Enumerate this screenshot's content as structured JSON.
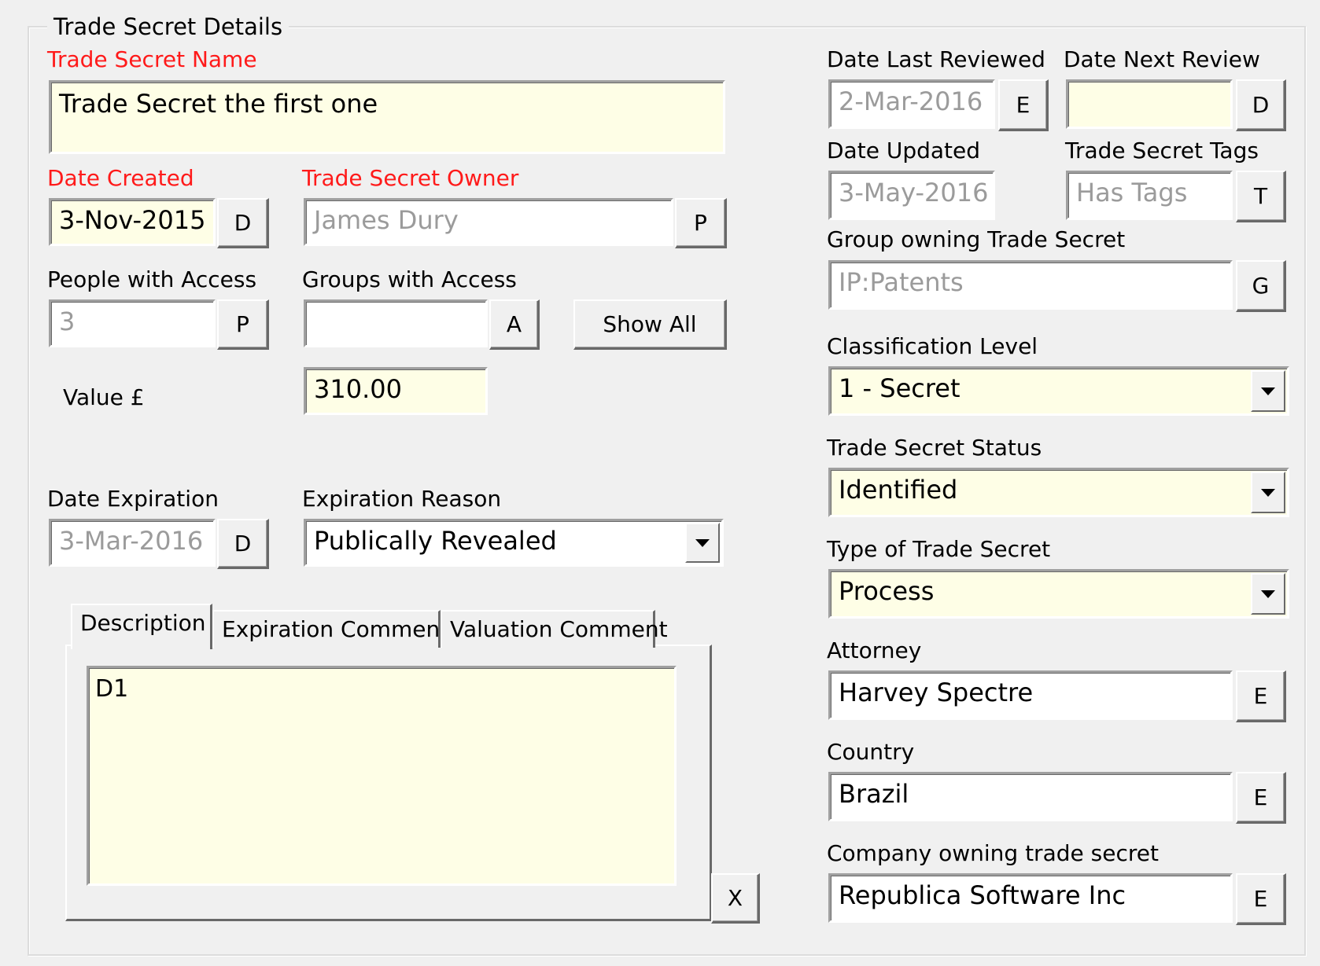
{
  "group_title": "Trade Secret Details",
  "name": {
    "label": "Trade Secret Name",
    "value": "Trade Secret the first one"
  },
  "date_created": {
    "label": "Date Created",
    "value": "3-Nov-2015",
    "button": "D"
  },
  "owner": {
    "label": "Trade Secret Owner",
    "value": "James Dury",
    "button": "P"
  },
  "people_access": {
    "label": "People with Access",
    "value": "3",
    "button": "P"
  },
  "groups_access": {
    "label": "Groups with Access",
    "value": "",
    "button": "A"
  },
  "show_all": "Show All",
  "value": {
    "label": "Value £",
    "value": "310.00"
  },
  "date_expiration": {
    "label": "Date Expiration",
    "value": "3-Mar-2016",
    "button": "D"
  },
  "expiration_reason": {
    "label": "Expiration Reason",
    "value": "Publically Revealed"
  },
  "tabs": {
    "items": [
      "Description",
      "Expiration Comment",
      "Valuation Comment"
    ],
    "active": "Description",
    "description_text": "D1",
    "close_button": "X"
  },
  "date_last_reviewed": {
    "label": "Date Last Reviewed",
    "value": "2-Mar-2016",
    "button": "E"
  },
  "date_next_review": {
    "label": "Date Next Review",
    "value": "",
    "button": "D"
  },
  "date_updated": {
    "label": "Date Updated",
    "value": "3-May-2016"
  },
  "tags": {
    "label": "Trade Secret Tags",
    "value": "Has Tags",
    "button": "T"
  },
  "group_owning": {
    "label": "Group owning Trade Secret",
    "value": "IP:Patents",
    "button": "G"
  },
  "classification": {
    "label": "Classification Level",
    "value": "1 - Secret"
  },
  "status": {
    "label": "Trade Secret Status",
    "value": "Identified"
  },
  "type": {
    "label": "Type of Trade Secret",
    "value": "Process"
  },
  "attorney": {
    "label": "Attorney",
    "value": "Harvey Spectre",
    "button": "E"
  },
  "country": {
    "label": "Country",
    "value": "Brazil",
    "button": "E"
  },
  "company": {
    "label": "Company owning trade secret",
    "value": "Republica Software Inc",
    "button": "E"
  },
  "colors": {
    "required_label": "#ff1a1a",
    "field_background": "#fefee6",
    "readonly_text": "#9b9b9b"
  }
}
